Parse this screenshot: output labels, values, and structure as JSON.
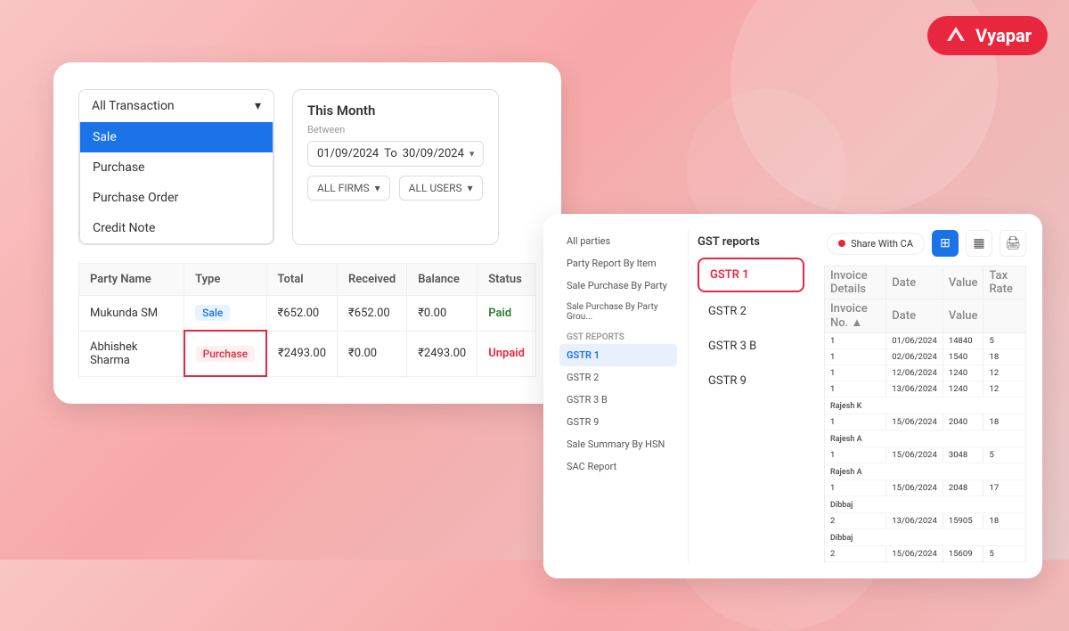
{
  "brand": {
    "name": "Vyapar",
    "logo_color": "#e8273e"
  },
  "left_card": {
    "dropdown": {
      "label": "All Transaction",
      "options": [
        {
          "id": "sale",
          "label": "Sale",
          "selected": true
        },
        {
          "id": "purchase",
          "label": "Purchase",
          "selected": false
        },
        {
          "id": "purchase_order",
          "label": "Purchase Order",
          "selected": false
        },
        {
          "id": "credit_note",
          "label": "Credit Note",
          "selected": false
        }
      ]
    },
    "date_section": {
      "title": "This Month",
      "between_label": "Between",
      "from_date": "01/09/2024",
      "to_date": "30/09/2024",
      "to_label": "To"
    },
    "firms_dropdown": "ALL FIRMS",
    "users_dropdown": "ALL USERS",
    "table": {
      "columns": [
        "Party Name",
        "Type",
        "Total",
        "Received",
        "Balance",
        "Status"
      ],
      "rows": [
        {
          "party_name": "Mukunda SM",
          "type": "Sale",
          "total": "₹652.00",
          "received": "₹652.00",
          "balance": "₹0.00",
          "status": "Paid",
          "status_class": "paid"
        },
        {
          "party_name": "Abhishek Sharma",
          "type": "Purchase",
          "total": "₹2493.00",
          "received": "₹0.00",
          "balance": "₹2493.00",
          "status": "Unpaid",
          "status_class": "unpaid",
          "highlight_type": true
        }
      ]
    }
  },
  "right_card": {
    "sidebar_items": [
      {
        "id": "all-parties",
        "label": "All parties"
      },
      {
        "id": "party-report-by-item",
        "label": "Party Report By Item"
      },
      {
        "id": "sale-purchase-by-party",
        "label": "Sale Purchase By Party"
      },
      {
        "id": "sale-purchase-by-party-group",
        "label": "Sale Purchase By Party Grou..."
      },
      {
        "id": "gst-reports",
        "label": "GST reports",
        "is_section": true
      },
      {
        "id": "gstr-1-sidebar",
        "label": "GSTR 1",
        "active": true
      },
      {
        "id": "gstr-2-sidebar",
        "label": "GSTR 2"
      },
      {
        "id": "gstr-3b-sidebar",
        "label": "GSTR 3 B"
      },
      {
        "id": "gstr-9-sidebar",
        "label": "GSTR 9"
      },
      {
        "id": "sale-summary-hsn",
        "label": "Sale Summary By HSN"
      },
      {
        "id": "sac-report",
        "label": "SAC Report"
      }
    ],
    "gst_panel": {
      "title": "GST reports",
      "options": [
        {
          "id": "gstr1",
          "label": "GSTR 1",
          "selected": true
        },
        {
          "id": "gstr2",
          "label": "GSTR 2",
          "selected": false
        },
        {
          "id": "gstr3b",
          "label": "GSTR 3 B",
          "selected": false
        },
        {
          "id": "gstr9",
          "label": "GSTR 9",
          "selected": false
        }
      ]
    },
    "share_btn": "Share With CA",
    "table_columns": [
      "Invoice No.",
      "Date",
      "Value",
      "Tax Rate"
    ],
    "table_rows": [
      {
        "invoice": "1",
        "date": "01/06/2024",
        "value": "14840",
        "rate": "5"
      },
      {
        "invoice": "1",
        "date": "02/06/2024",
        "value": "1540",
        "rate": "18"
      },
      {
        "invoice": "1",
        "date": "12/06/2024",
        "value": "1240",
        "rate": "12"
      },
      {
        "invoice": "1",
        "date": "13/06/2024",
        "value": "1240",
        "rate": "12"
      },
      {
        "section_header": "Rajesh K"
      },
      {
        "invoice": "1",
        "date": "15/06/2024",
        "value": "2040",
        "rate": "18"
      },
      {
        "section_header": "Rajesh A"
      },
      {
        "invoice": "1",
        "date": "15/06/2024",
        "value": "3048",
        "rate": "5"
      },
      {
        "section_header": "Rajesh A"
      },
      {
        "invoice": "1",
        "date": "15/06/2024",
        "value": "2048",
        "rate": "17"
      },
      {
        "section_header": "Dibbaj"
      },
      {
        "invoice": "2",
        "date": "13/06/2024",
        "value": "15905",
        "rate": "18"
      },
      {
        "section_header": "Dibbaj"
      },
      {
        "invoice": "2",
        "date": "15/06/2024",
        "value": "15609",
        "rate": "5"
      }
    ]
  }
}
